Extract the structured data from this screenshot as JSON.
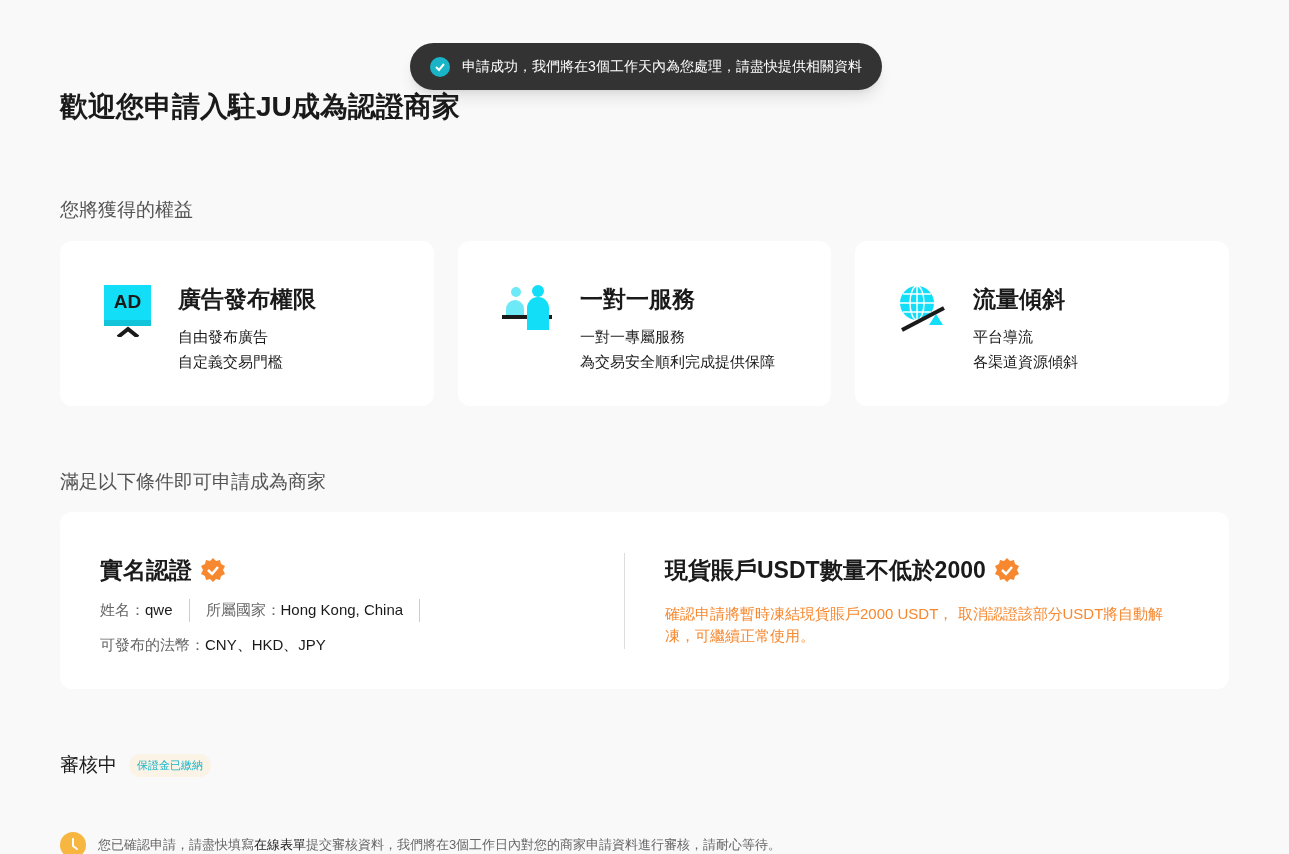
{
  "toast": {
    "kind": "success",
    "text": "申請成功，我們將在3個工作天內為您處理，請盡快提供相關資料"
  },
  "title": "歡迎您申請入駐JU成為認證商家",
  "benefits_heading": "您將獲得的權益",
  "benefits": [
    {
      "kind": "ad",
      "icon_text": "AD",
      "title": "廣告發布權限",
      "lines": [
        "自由發布廣告",
        "自定義交易門檻"
      ]
    },
    {
      "kind": "service",
      "title": "一對一服務",
      "lines": [
        "一對一專屬服務",
        "為交易安全順利完成提供保障"
      ]
    },
    {
      "kind": "traffic",
      "title": "流量傾斜",
      "lines": [
        "平台導流",
        "各渠道資源傾斜"
      ]
    }
  ],
  "requirements_heading": "滿足以下條件即可申請成為商家",
  "requirements": [
    {
      "kind": "identity",
      "title": "實名認證",
      "verified": true,
      "fields": [
        {
          "label": "姓名：",
          "value": "qwe"
        },
        {
          "label": "所屬國家：",
          "value": "Hong Kong, China"
        },
        {
          "label": "可發布的法幣：",
          "value": "CNY、HKD、JPY"
        }
      ]
    },
    {
      "kind": "deposit",
      "title": "現貨賬戶USDT數量不低於2000",
      "verified": true,
      "note": "確認申請將暫時凍結現貨賬戶2000 USDT， 取消認證該部分USDT將自動解凍，可繼續正常使用。"
    }
  ],
  "status": {
    "label": "審核中",
    "badge": "保證金已繳納"
  },
  "notice": {
    "before": "您已確認申請，請盡快填寫",
    "link": "在線表單",
    "after": "提交審核資料，我們將在3個工作日內對您的商家申請資料進行審核，請耐心等待。"
  }
}
